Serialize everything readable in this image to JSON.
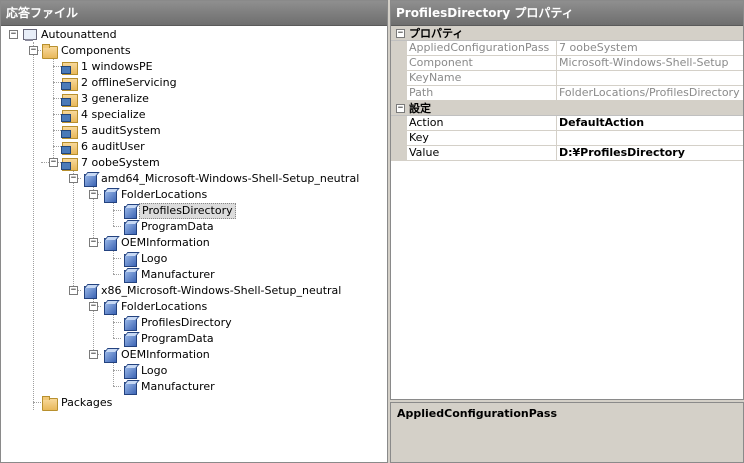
{
  "left_pane": {
    "title": "応答ファイル"
  },
  "tree": {
    "root": "Autounattend",
    "components": "Components",
    "passes": [
      "1 windowsPE",
      "2 offlineServicing",
      "3 generalize",
      "4 specialize",
      "5 auditSystem",
      "6 auditUser",
      "7 oobeSystem"
    ],
    "amd64": {
      "name": "amd64_Microsoft-Windows-Shell-Setup_neutral",
      "folder_locations": "FolderLocations",
      "profiles_directory": "ProfilesDirectory",
      "program_data": "ProgramData",
      "oem_information": "OEMInformation",
      "logo": "Logo",
      "manufacturer": "Manufacturer"
    },
    "x86": {
      "name": "x86_Microsoft-Windows-Shell-Setup_neutral",
      "folder_locations": "FolderLocations",
      "profiles_directory": "ProfilesDirectory",
      "program_data": "ProgramData",
      "oem_information": "OEMInformation",
      "logo": "Logo",
      "manufacturer": "Manufacturer"
    },
    "packages": "Packages"
  },
  "right_pane": {
    "title": "ProfilesDirectory プロパティ"
  },
  "properties": {
    "cat1": "プロパティ",
    "cat1_rows": [
      {
        "name": "AppliedConfigurationPass",
        "value": "7 oobeSystem"
      },
      {
        "name": "Component",
        "value": "Microsoft-Windows-Shell-Setup"
      },
      {
        "name": "KeyName",
        "value": ""
      },
      {
        "name": "Path",
        "value": "FolderLocations/ProfilesDirectory"
      }
    ],
    "cat2": "設定",
    "cat2_rows": [
      {
        "name": "Action",
        "value": "DefaultAction"
      },
      {
        "name": "Key",
        "value": ""
      },
      {
        "name": "Value",
        "value": "D:¥ProfilesDirectory"
      }
    ]
  },
  "description": {
    "title": "AppliedConfigurationPass"
  }
}
